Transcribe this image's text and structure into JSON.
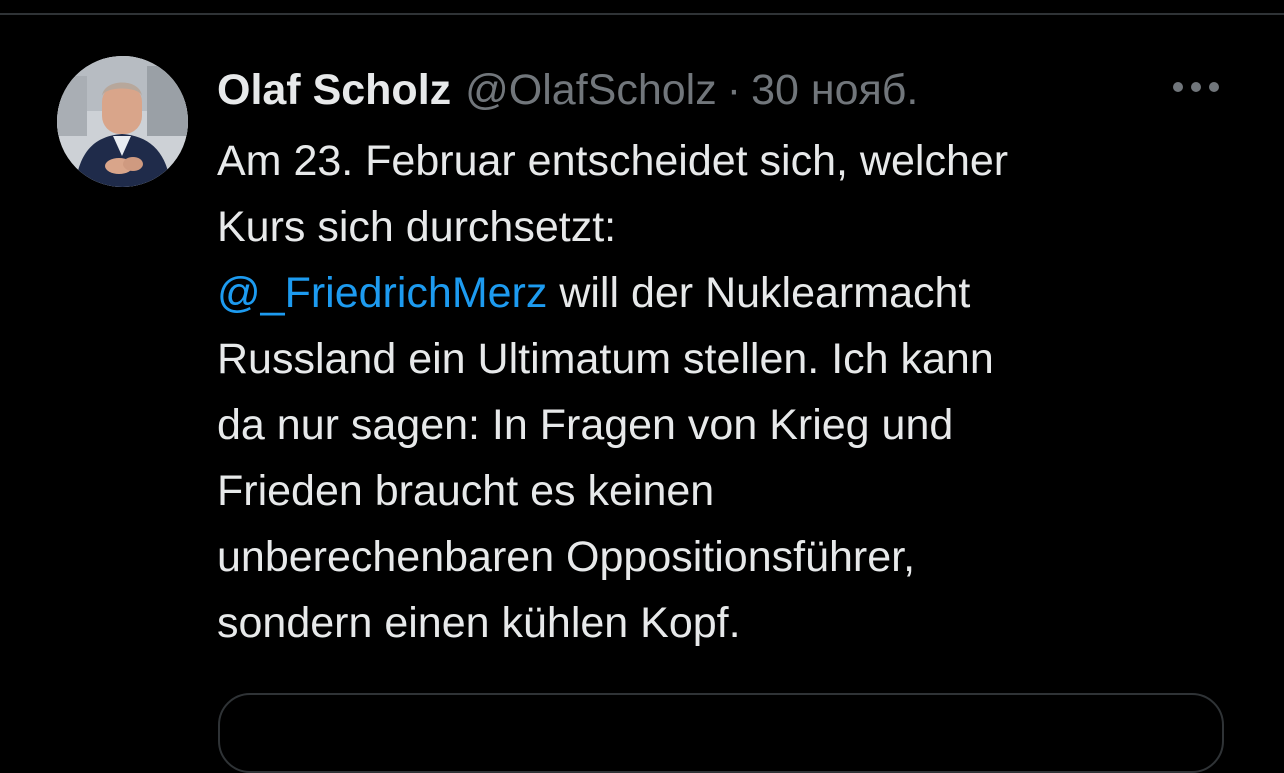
{
  "tweet": {
    "author": {
      "display_name": "Olaf Scholz",
      "handle": "@OlafScholz",
      "separator": "·",
      "timestamp": "30 нояб."
    },
    "more_icon": "more-horizontal-icon",
    "text": {
      "line1": "Am 23. Februar entscheidet sich, welcher",
      "line2": "Kurs sich durchsetzt:",
      "mention": "@_FriedrichMerz",
      "line3_rest": " will der Nuklearmacht",
      "line4": "Russland ein Ultimatum stellen. Ich kann",
      "line5": "da nur sagen: In Fragen von Krieg und",
      "line6": "Frieden braucht es keinen",
      "line7": "unberechenbaren Oppositionsführer,",
      "line8": "sondern einen kühlen Kopf."
    }
  },
  "colors": {
    "background": "#000000",
    "text_primary": "#e7e9ea",
    "text_secondary": "#71767b",
    "link": "#1d9bf0",
    "divider": "#2f3336"
  }
}
